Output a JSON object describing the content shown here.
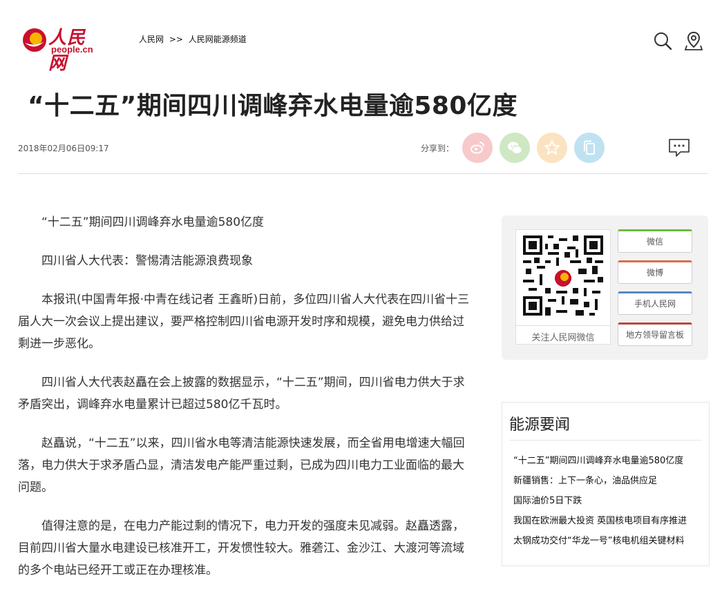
{
  "header": {
    "logo_cn": "人民网",
    "logo_en": "people.cn",
    "breadcrumb": [
      "人民网",
      ">>",
      "人民网能源频道"
    ]
  },
  "article": {
    "title": "“十二五”期间四川调峰弃水电量逾580亿度",
    "date": "2018年02月06日09:17",
    "share_label": "分享到：",
    "paragraphs": [
      "“十二五”期间四川调峰弃水电量逾580亿度",
      "四川省人大代表：警惕清洁能源浪费现象",
      "本报讯(中国青年报·中青在线记者 王鑫昕)日前，多位四川省人大代表在四川省十三届人大一次会议上提出建议，要严格控制四川省电源开发时序和规模，避免电力供给过剩进一步恶化。",
      "四川省人大代表赵矗在会上披露的数据显示，“十二五”期间，四川省电力供大于求矛盾突出，调峰弃水电量累计已超过580亿千瓦时。",
      "赵矗说，“十二五”以来，四川省水电等清洁能源快速发展，而全省用电增速大幅回落，电力供大于求矛盾凸显，清洁发电产能严重过剩，已成为四川电力工业面临的最大问题。",
      "值得注意的是，在电力产能过剩的情况下，电力开发的强度未见减弱。赵矗透露，目前四川省大量水电建设已核准开工，开发惯性较大。雅砻江、金沙江、大渡河等流域的多个电站已经开工或正在办理核准。"
    ]
  },
  "share": {
    "colors": {
      "weibo": "#f7c9cb",
      "wechat": "#cfe8c4",
      "favorite": "#fbe3c1",
      "copy": "#bfe2f1"
    },
    "icons": [
      "weibo-icon",
      "wechat-icon",
      "star-icon",
      "copy-icon"
    ]
  },
  "sidebar": {
    "qr_caption": "关注人民网微信",
    "links": [
      {
        "label": "微信",
        "color": "#6dbb3d"
      },
      {
        "label": "微博",
        "color": "#e0694a"
      },
      {
        "label": "手机人民网",
        "color": "#5a86c4"
      },
      {
        "label": "地方领导留言板",
        "color": "#c0443f"
      }
    ]
  },
  "news": {
    "title": "能源要闻",
    "items": [
      "“十二五”期间四川调峰弃水电量逾580亿度",
      "新疆销售：上下一条心，油品供应足",
      "国际油价5日下跌",
      "我国在欧洲最大投资 英国核电项目有序推进",
      "太钢成功交付“华龙一号”核电机组关键材料"
    ]
  }
}
